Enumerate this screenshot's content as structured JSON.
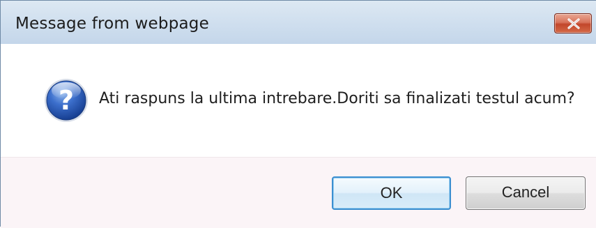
{
  "window": {
    "title": "Message from webpage",
    "close_icon": "close-icon"
  },
  "message": {
    "icon": "question-icon",
    "text": "Ati raspuns la ultima intrebare.Doriti sa finalizati testul acum?"
  },
  "buttons": {
    "ok_label": "OK",
    "cancel_label": "Cancel"
  },
  "colors": {
    "titlebar": "#d1e0ef",
    "close_button": "#c2462b",
    "ok_border": "#3c8fd0",
    "icon_blue": "#1f4fa8"
  }
}
